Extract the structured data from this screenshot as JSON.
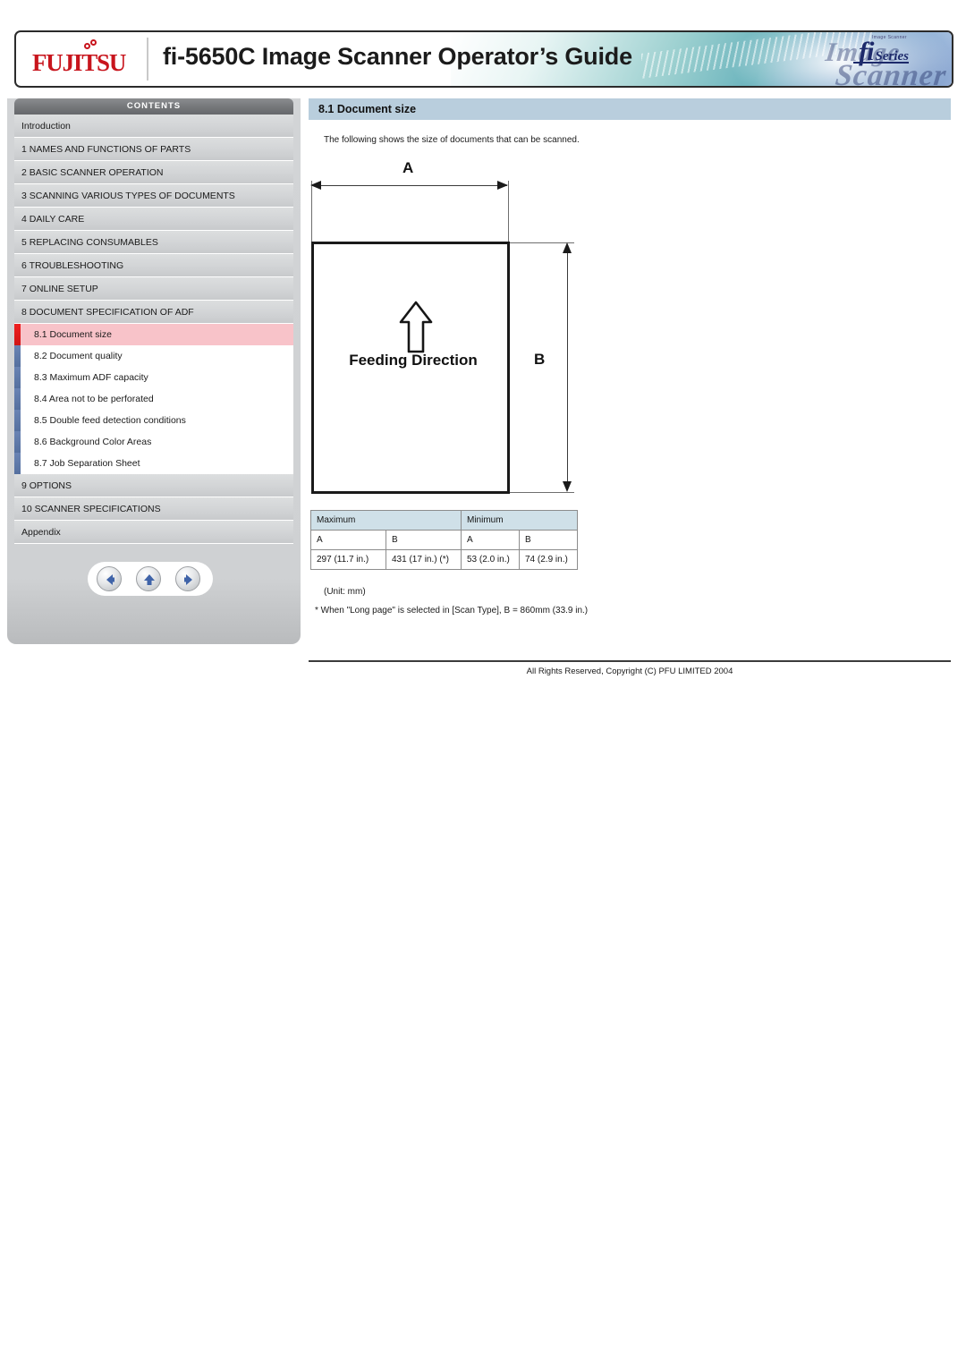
{
  "header": {
    "brand": "FUJITSU",
    "title": "fi-5650C Image Scanner Operator’s Guide",
    "fi_mark": "fi",
    "fi_series": "Series",
    "fi_tiny": "Image Scanner",
    "gfx_word_image": "Image",
    "gfx_word_scanner": "Scanner"
  },
  "sidebar": {
    "heading": "CONTENTS",
    "items": [
      {
        "label": "Introduction",
        "type": "top"
      },
      {
        "label": "1 NAMES AND FUNCTIONS OF PARTS",
        "type": "top"
      },
      {
        "label": "2 BASIC SCANNER OPERATION",
        "type": "top"
      },
      {
        "label": "3 SCANNING VARIOUS TYPES OF DOCUMENTS",
        "type": "top"
      },
      {
        "label": "4 DAILY CARE",
        "type": "top"
      },
      {
        "label": "5 REPLACING CONSUMABLES",
        "type": "top"
      },
      {
        "label": "6 TROUBLESHOOTING",
        "type": "top"
      },
      {
        "label": "7 ONLINE SETUP",
        "type": "top"
      },
      {
        "label": "8 DOCUMENT SPECIFICATION OF ADF",
        "type": "top"
      }
    ],
    "subitems": [
      {
        "label": "8.1 Document size",
        "active": true
      },
      {
        "label": "8.2 Document quality",
        "active": false
      },
      {
        "label": "8.3 Maximum ADF capacity",
        "active": false
      },
      {
        "label": "8.4 Area not to be perforated",
        "active": false
      },
      {
        "label": "8.5 Double feed detection conditions",
        "active": false
      },
      {
        "label": "8.6 Background Color Areas",
        "active": false
      },
      {
        "label": "8.7 Job Separation Sheet",
        "active": false
      }
    ],
    "items_tail": [
      {
        "label": "9 OPTIONS",
        "type": "top"
      },
      {
        "label": "10 SCANNER SPECIFICATIONS",
        "type": "top"
      },
      {
        "label": "Appendix",
        "type": "top"
      }
    ],
    "nav": {
      "back": "back-arrow",
      "up": "up-arrow",
      "forward": "forward-arrow"
    },
    "colors": {
      "active_row": "#f8c3c9",
      "active_bar": "#f02020",
      "sub_bar": "#5a75a6",
      "heading_bg": "#76787b"
    }
  },
  "content": {
    "heading": "8.1 Document size",
    "intro": "The following shows the size of documents that can be scanned.",
    "diagram": {
      "label_a": "A",
      "label_b": "B",
      "feeding_direction": "Feeding Direction"
    },
    "table": {
      "group_headers": [
        "Maximum",
        "Minimum"
      ],
      "column_headers": [
        "A",
        "B",
        "A",
        "B"
      ],
      "values": [
        "297 (11.7 in.)",
        "431 (17 in.) (*)",
        "53 (2.0 in.)",
        "74 (2.9 in.)"
      ]
    },
    "unit_note": "(Unit: mm)",
    "footnote": "* When \"Long page\" is selected in [Scan Type], B = 860mm (33.9 in.)"
  },
  "footer": {
    "copyright": "All Rights Reserved, Copyright (C) PFU LIMITED 2004"
  }
}
